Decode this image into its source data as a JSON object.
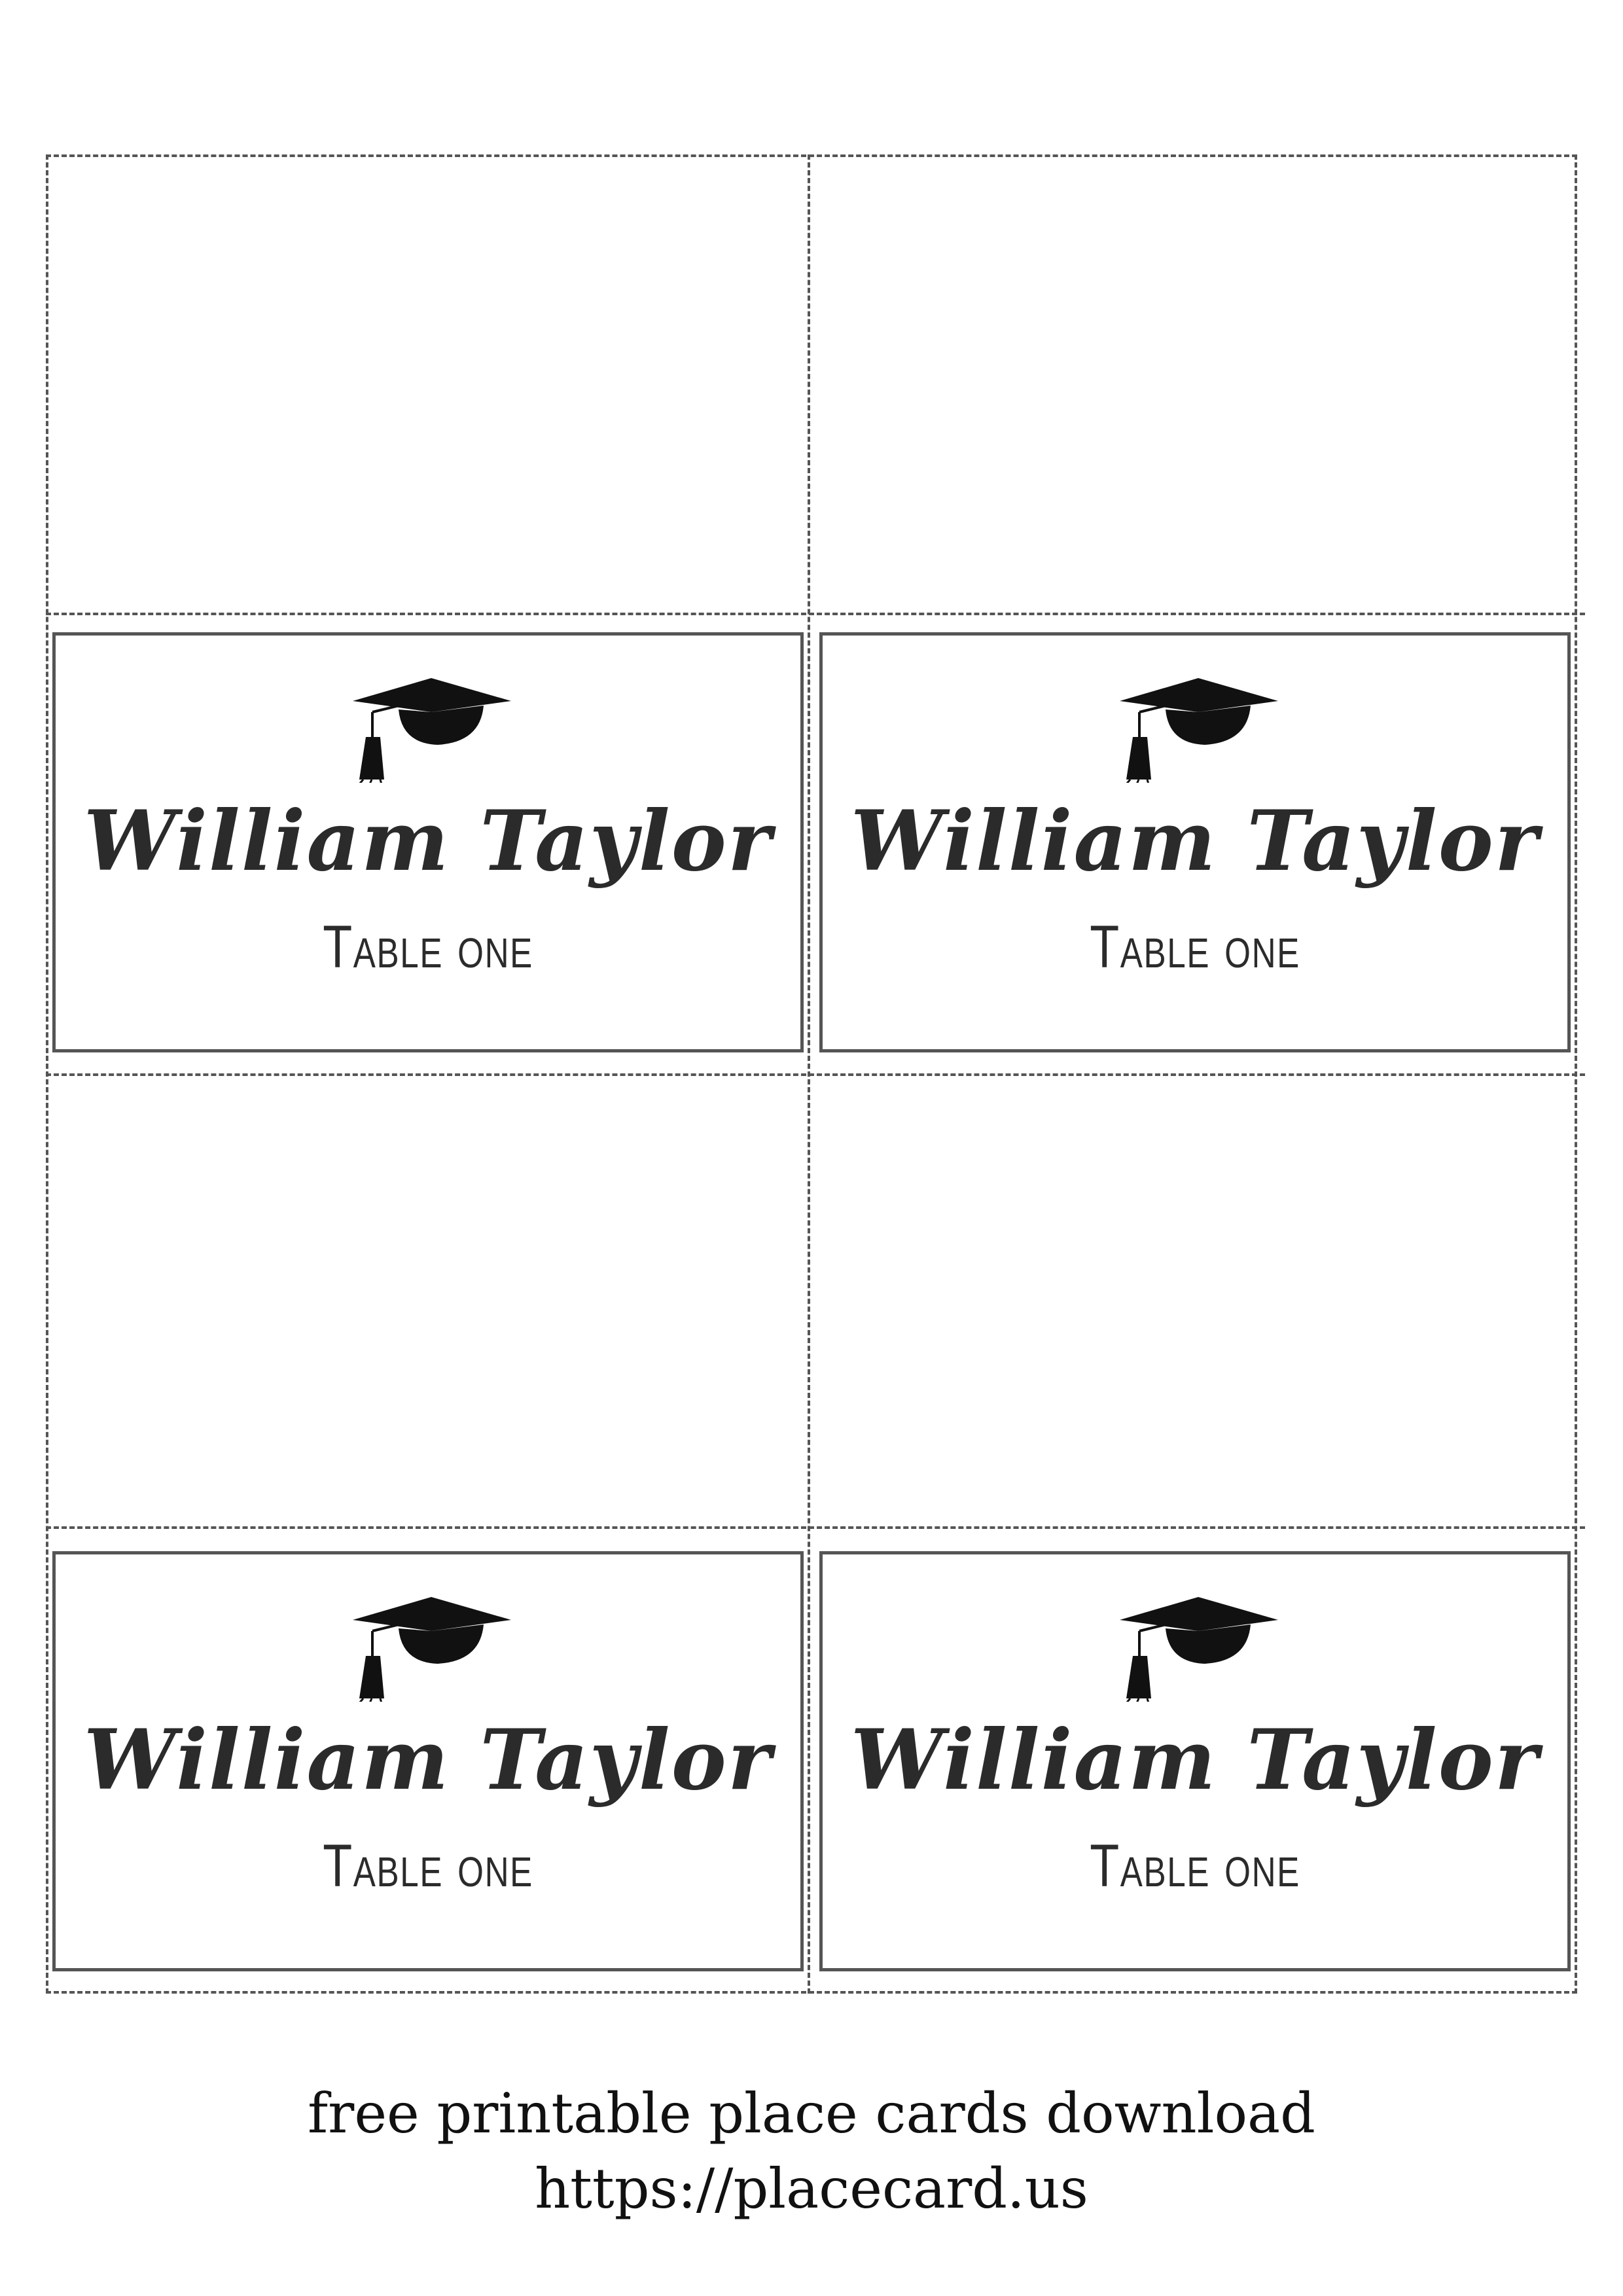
{
  "cards": [
    {
      "name": "William Taylor",
      "table": "Table one",
      "icon": "graduation-cap-icon"
    },
    {
      "name": "William Taylor",
      "table": "Table one",
      "icon": "graduation-cap-icon"
    },
    {
      "name": "William Taylor",
      "table": "Table one",
      "icon": "graduation-cap-icon"
    },
    {
      "name": "William Taylor",
      "table": "Table one",
      "icon": "graduation-cap-icon"
    }
  ],
  "footer": {
    "line1": "free printable place cards download",
    "line2": "https://placecard.us"
  }
}
